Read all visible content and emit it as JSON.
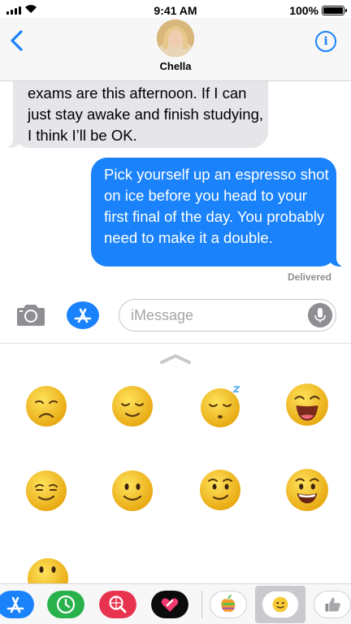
{
  "status_bar": {
    "time": "9:41 AM",
    "battery": "100%",
    "icons": [
      "signal-icon",
      "wifi-icon",
      "battery-icon"
    ]
  },
  "header": {
    "back_icon": "chevron-left-icon",
    "contact_name": "Chella",
    "info_icon": "info-icon",
    "info_glyph": "i"
  },
  "messages": [
    {
      "direction": "incoming",
      "text": "exams are this afternoon. If I can just stay awake and finish studying, I think I’ll be OK."
    },
    {
      "direction": "outgoing",
      "text": "Pick yourself up an espresso shot on ice before you head to your first final of the day. You probably need to make it a double.",
      "status": "Delivered"
    }
  ],
  "input": {
    "placeholder": "iMessage",
    "icons": [
      "camera-icon",
      "app-store-icon",
      "microphone-icon"
    ]
  },
  "drawer": {
    "handle_icon": "chevron-up-icon",
    "stickers": [
      "sad-face-sticker",
      "relieved-face-sticker",
      "sleeping-face-sticker",
      "laughing-face-sticker",
      "smirking-face-sticker",
      "smiling-face-sticker",
      "side-eye-face-sticker",
      "grinning-face-sticker",
      "partial-face-sticker"
    ]
  },
  "app_strip": {
    "apps": [
      "app-store-icon",
      "recents-clock-icon",
      "web-search-icon",
      "digital-touch-icon",
      "apple-sticker-icon",
      "smiley-sticker-icon",
      "thumbs-up-icon"
    ],
    "selected": "smiley-sticker-icon"
  },
  "colors": {
    "accent": "#1a82fb",
    "incoming_bubble": "#e5e5ea",
    "emoji_yellow": "#f7c934"
  }
}
